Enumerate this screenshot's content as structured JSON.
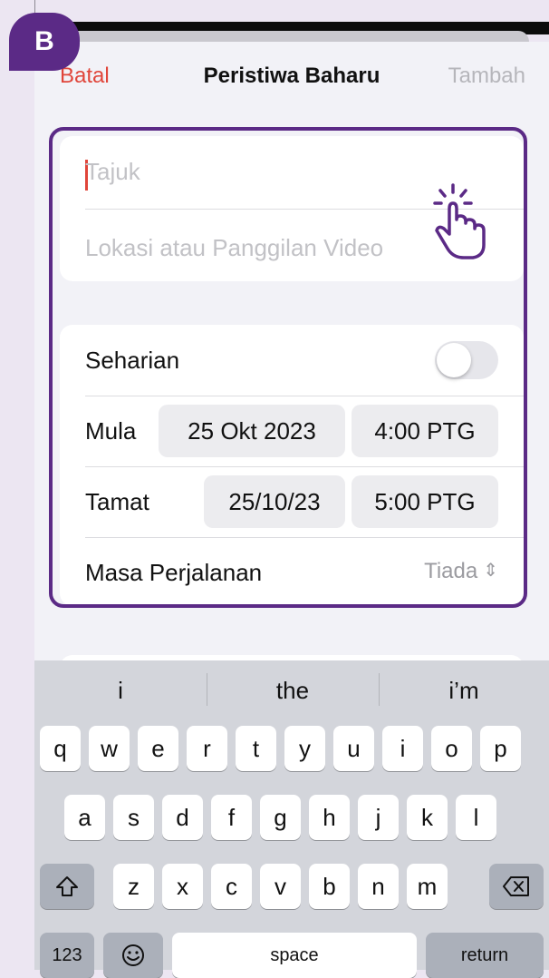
{
  "badge": {
    "letter": "B"
  },
  "nav": {
    "cancel": "Batal",
    "title": "Peristiwa Baharu",
    "add": "Tambah"
  },
  "event": {
    "title_placeholder": "Tajuk",
    "location_placeholder": "Lokasi atau Panggilan Video"
  },
  "details": {
    "allday_label": "Seharian",
    "allday_on": false,
    "start_label": "Mula",
    "start_date": "25 Okt 2023",
    "start_time": "4:00 PTG",
    "end_label": "Tamat",
    "end_date": "25/10/23",
    "end_time": "5:00 PTG",
    "travel_label": "Masa Perjalanan",
    "travel_value": "Tiada"
  },
  "keyboard": {
    "suggestions": [
      "i",
      "the",
      "i’m"
    ],
    "row1": [
      "q",
      "w",
      "e",
      "r",
      "t",
      "y",
      "u",
      "i",
      "o",
      "p"
    ],
    "row2": [
      "a",
      "s",
      "d",
      "f",
      "g",
      "h",
      "j",
      "k",
      "l"
    ],
    "row3": [
      "z",
      "x",
      "c",
      "v",
      "b",
      "n",
      "m"
    ],
    "numbers": "123",
    "space": "space",
    "return": "return"
  },
  "colors": {
    "accent": "#5b2a86",
    "cancel": "#e0453a",
    "disabled": "#b6b6bb"
  },
  "icons": {
    "shift": "shift-icon",
    "delete": "delete-icon",
    "emoji": "emoji-icon",
    "tap": "tap-hand-icon",
    "updown": "chevron-up-down-icon"
  }
}
